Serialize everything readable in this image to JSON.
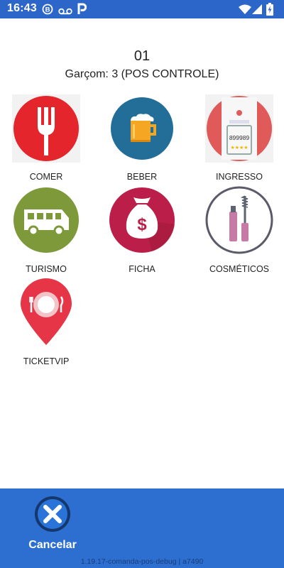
{
  "status_bar": {
    "time": "16:43",
    "icons": [
      "b-circle-icon",
      "voicemail-icon",
      "p-icon",
      "wifi-icon",
      "signal-icon",
      "battery-charging-icon"
    ]
  },
  "header": {
    "table_number": "01",
    "waiter": "Garçom: 3 (POS CONTROLE)"
  },
  "categories": [
    {
      "label": "COMER",
      "icon": "fork-icon"
    },
    {
      "label": "BEBER",
      "icon": "beer-mug-icon"
    },
    {
      "label": "INGRESSO",
      "icon": "ticket-icon",
      "ticket_text": "899989",
      "stars": 4
    },
    {
      "label": "TURISMO",
      "icon": "bus-icon"
    },
    {
      "label": "FICHA",
      "icon": "money-bag-icon"
    },
    {
      "label": "COSMÉTICOS",
      "icon": "mascara-icon"
    },
    {
      "label": "TICKETVIP",
      "icon": "map-pin-plate-icon"
    }
  ],
  "footer": {
    "cancel_label": "Cancelar",
    "version": "1.19.17-comanda-pos-debug | a7490"
  },
  "colors": {
    "status_bar": "#2c66c9",
    "bottom_bar": "#2c6fd1"
  }
}
